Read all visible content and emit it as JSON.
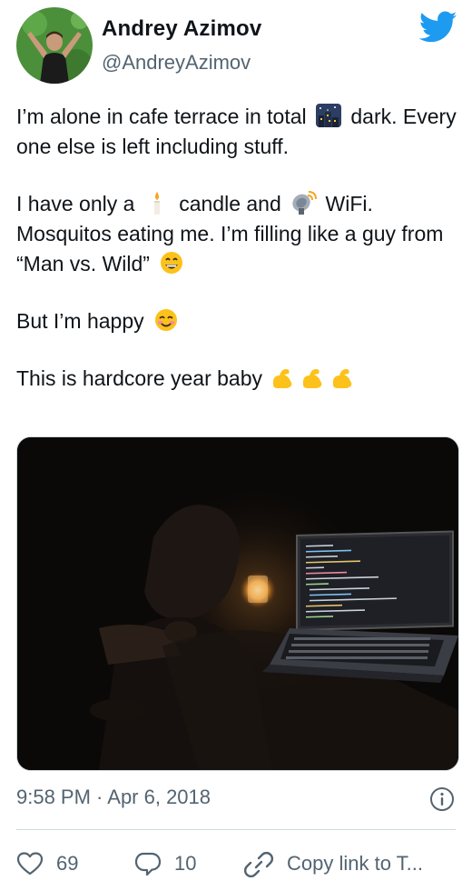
{
  "author": {
    "name": "Andrey Azimov",
    "handle": "@AndreyAzimov"
  },
  "tweet": {
    "p1_a": "I’m alone in cafe terrace in total",
    "p1_b": "dark. Every one else is left including stuff.",
    "p2_a": "I have only a",
    "p2_b": "candle and",
    "p2_c": "WiFi. Mosquitos eating me. I’m filling like a guy from “Man vs. Wild”",
    "p3": "But I’m happy",
    "p4": "This is hardcore year baby"
  },
  "icons": [
    "avatar",
    "twitter-bird-icon",
    "city-night-emoji-icon",
    "candle-emoji-icon",
    "satellite-antenna-emoji-icon",
    "grinning-emoji-icon",
    "smiling-blush-emoji-icon",
    "flexed-biceps-emoji-icon",
    "info-icon",
    "heart-icon",
    "reply-icon",
    "link-icon"
  ],
  "meta": {
    "timestamp": "9:58 PM · Apr 6, 2018"
  },
  "actions": {
    "likes": "69",
    "replies": "10",
    "copy_link": "Copy link to T..."
  },
  "colors": {
    "brand": "#1d9bf0",
    "text": "#0f1419",
    "secondary": "#536471",
    "divider": "#cfd9de"
  }
}
